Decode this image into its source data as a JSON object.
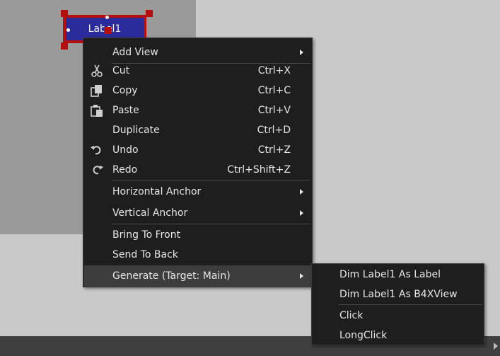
{
  "label_view": {
    "text": "Label1"
  },
  "context_menu": {
    "add_view": "Add View",
    "cut": {
      "label": "Cut",
      "shortcut": "Ctrl+X",
      "icon": "scissors-icon"
    },
    "copy": {
      "label": "Copy",
      "shortcut": "Ctrl+C",
      "icon": "copy-icon"
    },
    "paste": {
      "label": "Paste",
      "shortcut": "Ctrl+V",
      "icon": "paste-icon"
    },
    "duplicate": {
      "label": "Duplicate",
      "shortcut": "Ctrl+D"
    },
    "undo": {
      "label": "Undo",
      "shortcut": "Ctrl+Z",
      "icon": "undo-icon"
    },
    "redo": {
      "label": "Redo",
      "shortcut": "Ctrl+Shift+Z",
      "icon": "redo-icon"
    },
    "horizontal_anchor": "Horizontal Anchor",
    "vertical_anchor": "Vertical Anchor",
    "bring_to_front": "Bring To Front",
    "send_to_back": "Send To Back",
    "generate": "Generate (Target: Main)"
  },
  "submenu": {
    "dim_as_label": "Dim Label1 As Label",
    "dim_as_b4xview": "Dim Label1 As B4XView",
    "click": "Click",
    "long_click": "LongClick"
  },
  "colors": {
    "menu_background": "#1e1e1e",
    "menu_highlight": "#3d3d3d",
    "menu_text": "#e6e6e6",
    "label_fill": "#2b2b9b",
    "selection_red": "#b50e0e",
    "designer_background": "#9a9a9a",
    "canvas_background": "#c9c9c9"
  }
}
